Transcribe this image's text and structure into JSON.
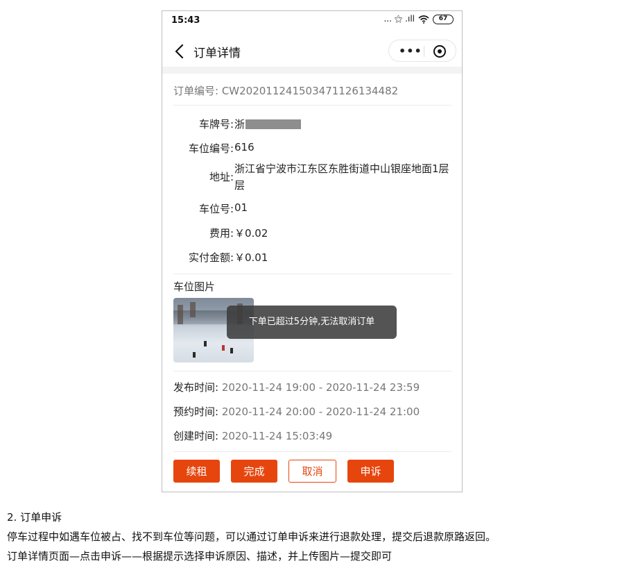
{
  "status_bar": {
    "time": "15:43",
    "icons_text": "... ⚝ .ıll",
    "battery": "67"
  },
  "nav": {
    "title": "订单详情",
    "more_label": "•••"
  },
  "order": {
    "order_no": "订单编号: CW202011241503471126134482",
    "fields": [
      {
        "label": "车牌号:",
        "value": "浙"
      },
      {
        "label": "车位编号:",
        "value": "616"
      },
      {
        "label": "地址:",
        "value": "浙江省宁波市江东区东胜街道中山银座地面1层层"
      },
      {
        "label": "车位号:",
        "value": "01"
      },
      {
        "label": "费用:",
        "value": "￥0.02"
      },
      {
        "label": "实付金额:",
        "value": "￥0.01"
      }
    ],
    "photo_title": "车位图片",
    "times": [
      {
        "label": "发布时间:",
        "value": "2020-11-24 19:00 - 2020-11-24 23:59"
      },
      {
        "label": "预约时间:",
        "value": "2020-11-24 20:00 - 2020-11-24 21:00"
      },
      {
        "label": "创建时间:",
        "value": "2020-11-24 15:03:49"
      }
    ]
  },
  "toast": "下单已超过5分钟,无法取消订单",
  "actions": {
    "renew": "续租",
    "complete": "完成",
    "cancel": "取消",
    "appeal": "申诉"
  },
  "doc": {
    "heading": "2. 订单申诉",
    "para1": "停车过程中如遇车位被占、找不到车位等问题，可以通过订单申诉来进行退款处理，提交后退款原路返回。",
    "para2": "订单详情页面—点击申诉——根据提示选择申诉原因、描述，并上传图片—提交即可"
  },
  "colors": {
    "accent": "#e6460e",
    "toast_bg": "#3c3c3c"
  }
}
